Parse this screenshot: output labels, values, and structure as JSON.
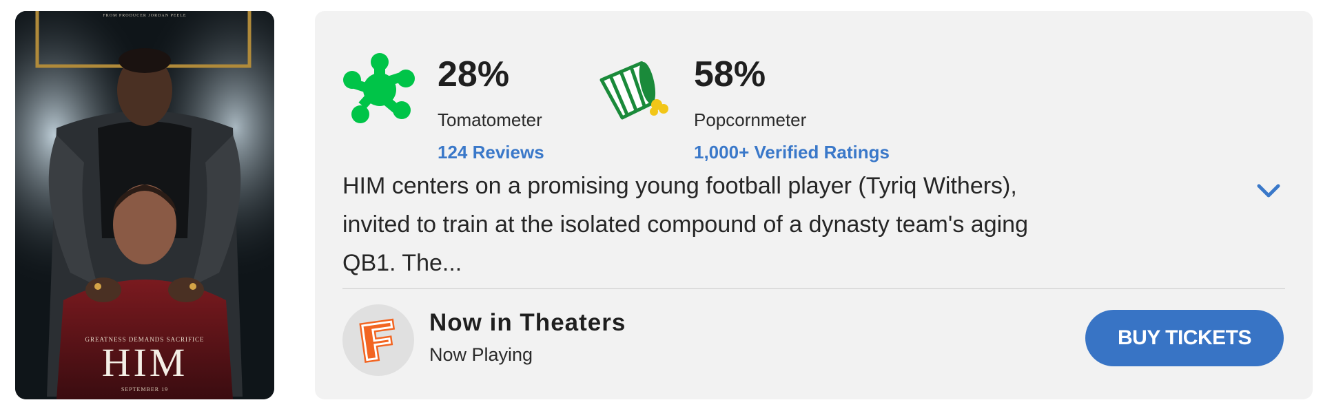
{
  "poster": {
    "alt_title": "HIM",
    "tagline": "GREATNESS DEMANDS SACRIFICE",
    "release": "SEPTEMBER 19",
    "top_credit": "FROM PRODUCER JORDAN PEELE"
  },
  "tomatometer": {
    "value": "28%",
    "label": "Tomatometer",
    "link": "124 Reviews",
    "icon": "splat-icon",
    "color": "#00c448"
  },
  "popcornmeter": {
    "value": "58%",
    "label": "Popcornmeter",
    "link": "1,000+ Verified Ratings",
    "icon": "tipped-popcorn-bucket-icon",
    "color": "#1a8a3a"
  },
  "synopsis": {
    "text": "HIM centers on a promising young football player (Tyriq Withers), invited to train at the isolated compound of a dynasty team's aging QB1. The..."
  },
  "theaters": {
    "title": "Now in Theaters",
    "subtitle": "Now Playing",
    "logo": "fandango-icon",
    "button": "BUY TICKETS",
    "button_color": "#3874c5"
  },
  "link_color": "#3a78c9"
}
